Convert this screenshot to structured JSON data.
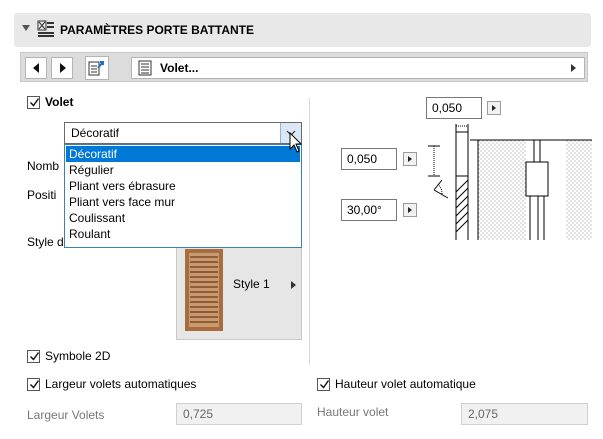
{
  "header": {
    "title": "PARAMÈTRES PORTE BATTANTE",
    "icon": "door-settings-icon"
  },
  "navbar": {
    "selected": "Volet...",
    "icons": [
      "prev-arrow-icon",
      "next-arrow-icon",
      "export-page-icon",
      "page-list-icon",
      "submenu-arrow-icon"
    ]
  },
  "volet": {
    "label": "Volet",
    "checked": true,
    "type_value": "Décoratif",
    "options": [
      "Décoratif",
      "Régulier",
      "Pliant vers ébrasure",
      "Pliant vers face mur",
      "Coulissant",
      "Roulant"
    ],
    "selected_index": 0
  },
  "partial_labels": {
    "nombre": "Nomb",
    "position": "Positi",
    "style": "Style d"
  },
  "style_preview": {
    "label": "Style 1"
  },
  "dimensions": {
    "top_value": "0,050",
    "offset_value": "0,050",
    "angle_value": "30,00°"
  },
  "options": {
    "symbole_2d": "Symbole 2D",
    "largeur_auto": "Largeur volets automatiques",
    "hauteur_auto": "Hauteur volet automatique"
  },
  "fields": {
    "largeur_label": "Largeur Volets",
    "largeur_value": "0,725",
    "hauteur_label": "Hauteur volet",
    "hauteur_value": "2,075"
  },
  "colors": {
    "accent": "#0078d7",
    "header_bg": "#e8e8e8",
    "wood": "#a86d3e"
  }
}
